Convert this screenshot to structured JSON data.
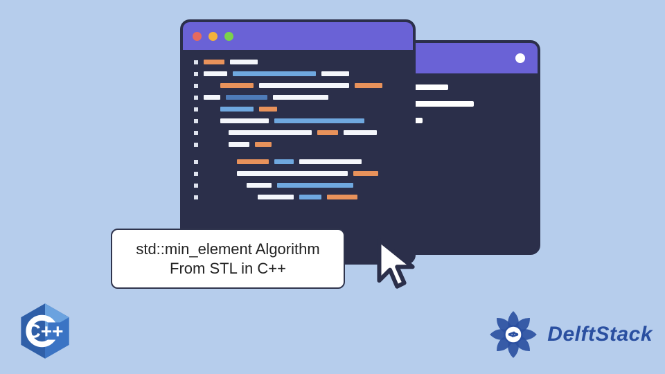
{
  "caption": {
    "line1": "std::min_element Algorithm",
    "line2": "From STL in C++"
  },
  "brand": {
    "name": "DelftStack"
  },
  "cpp_badge": {
    "text": "C++"
  },
  "colors": {
    "page_bg": "#b6cdec",
    "window_titlebar": "#6a62d6",
    "window_body": "#2b2f4a",
    "code_white": "#f4f6fb",
    "code_blue": "#6fa8df",
    "code_orange": "#e8925b",
    "code_dark_blue": "#4e7bb8",
    "brand_blue": "#2a4fa0",
    "traffic_red": "#e66a5e",
    "traffic_yellow": "#f3b23c",
    "traffic_green": "#7bd24b"
  },
  "icons": {
    "cursor": "cursor-arrow-icon",
    "mandala": "mandala-icon",
    "cpp": "cpp-hex-icon",
    "traffic_close": "traffic-light-close",
    "traffic_min": "traffic-light-minimize",
    "traffic_max": "traffic-light-maximize"
  }
}
